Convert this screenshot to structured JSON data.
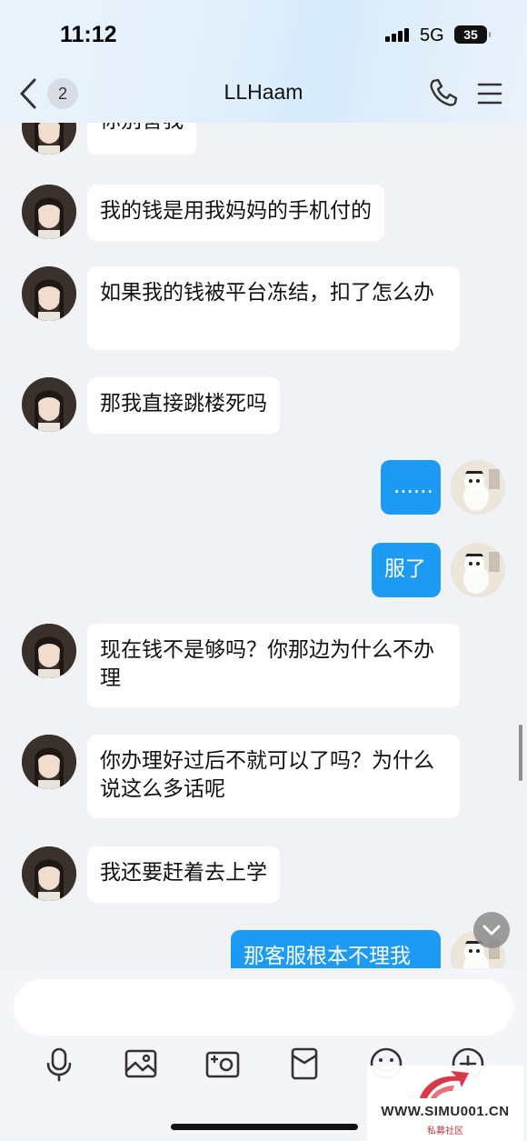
{
  "status_bar": {
    "time": "11:12",
    "network": "5G",
    "battery": "35"
  },
  "header": {
    "unread_count": "2",
    "title": "LLHaam"
  },
  "messages": [
    {
      "side": "in",
      "text": "你别害我"
    },
    {
      "side": "in",
      "text": "我的钱是用我妈妈的手机付的"
    },
    {
      "side": "in",
      "text": "如果我的钱被平台冻结，扣了怎么办"
    },
    {
      "side": "in",
      "text": "那我直接跳楼死吗"
    },
    {
      "side": "out",
      "text": "......"
    },
    {
      "side": "out",
      "text": "服了"
    },
    {
      "side": "in",
      "text": "现在钱不是够吗？你那边为什么不办理"
    },
    {
      "side": "in",
      "text": "你办理好过后不就可以了吗？为什么说这么多话呢"
    },
    {
      "side": "in",
      "text": "我还要赶着去上学"
    },
    {
      "side": "out",
      "text": "那客服根本不理我"
    }
  ],
  "input": {
    "value": ""
  },
  "toolbar": [
    "microphone-icon",
    "image-icon",
    "camera-icon",
    "red-packet-icon",
    "emoji-icon",
    "plus-icon"
  ],
  "watermark": {
    "text": "WWW.SIMU001.CN",
    "subtitle": "私募社区"
  },
  "colors": {
    "outgoing_bubble": "#1d9bf4",
    "incoming_bubble": "#ffffff",
    "background": "#f1f2f6"
  }
}
